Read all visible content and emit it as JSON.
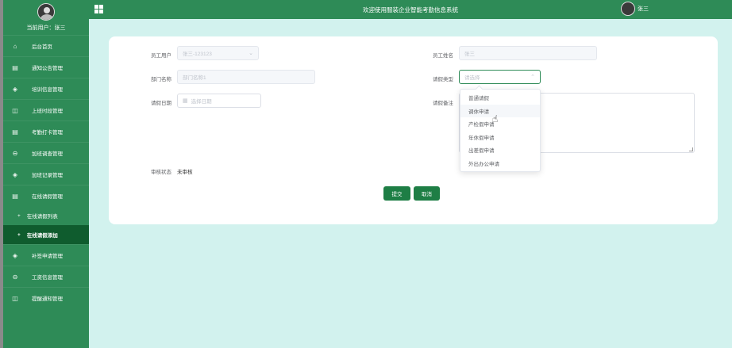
{
  "sidebar": {
    "current_user_label": "当前用户：",
    "current_user_name": "张三",
    "items": [
      {
        "label": "后台首页",
        "icon": "home-icon"
      },
      {
        "label": "通知公告管理",
        "icon": "document-icon"
      },
      {
        "label": "培训信息管理",
        "icon": "shield-icon"
      },
      {
        "label": "上班时段管理",
        "icon": "columns-icon"
      },
      {
        "label": "考勤打卡管理",
        "icon": "document-icon"
      },
      {
        "label": "加班调查管理",
        "icon": "chat-icon"
      },
      {
        "label": "加班记录管理",
        "icon": "shield-icon"
      },
      {
        "label": "在线请假管理",
        "icon": "document-icon"
      }
    ],
    "sub_items": [
      {
        "label": "在线请假列表"
      },
      {
        "label": "在线请假添加"
      }
    ],
    "items_after": [
      {
        "label": "补签申请管理",
        "icon": "shield-icon"
      },
      {
        "label": "工资信息管理",
        "icon": "chat-icon"
      },
      {
        "label": "提醒通知管理",
        "icon": "columns-icon"
      }
    ]
  },
  "topbar": {
    "title": "欢迎使用服装企业智能考勤信息系统",
    "user_name": "张三"
  },
  "form": {
    "employee_user_label": "员工用户",
    "employee_user_value": "张三-123123",
    "employee_name_label": "员工姓名",
    "employee_name_value": "张三",
    "department_label": "部门名称",
    "department_value": "部门名称1",
    "leave_type_label": "请假类型",
    "leave_type_placeholder": "请选择",
    "leave_date_label": "请假日期",
    "leave_date_placeholder": "选择日期",
    "remark_label": "请假备注",
    "review_status_label": "审核状态",
    "review_status_value": "未审核",
    "submit_label": "提交",
    "cancel_label": "取消"
  },
  "dropdown": {
    "options": [
      "普通请假",
      "调休申请",
      "产检假申请",
      "年休假申请",
      "出差假申请",
      "外出办公申请"
    ],
    "hovered_index": 1
  },
  "colors": {
    "sidebar_bg": "#2e8b57",
    "active_item_bg": "#0f5c2e",
    "content_bg": "#d2f2ee",
    "button_bg": "#1e7e45"
  }
}
